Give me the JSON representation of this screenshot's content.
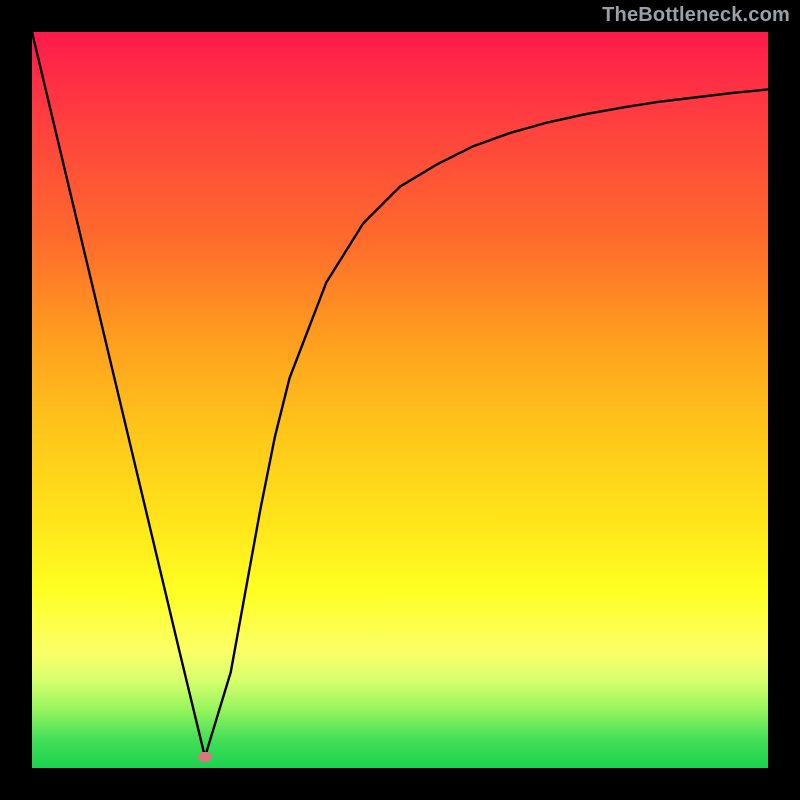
{
  "watermark": "TheBottleneck.com",
  "chart_data": {
    "type": "line",
    "title": "",
    "xlabel": "",
    "ylabel": "",
    "xlim": [
      0,
      1
    ],
    "ylim": [
      0,
      1
    ],
    "grid": false,
    "legend": false,
    "series": [
      {
        "name": "curve",
        "stroke": "#000000",
        "stroke_width": 2.4,
        "x": [
          0.0,
          0.05,
          0.1,
          0.15,
          0.2,
          0.235,
          0.27,
          0.29,
          0.31,
          0.33,
          0.35,
          0.4,
          0.45,
          0.5,
          0.55,
          0.6,
          0.65,
          0.7,
          0.75,
          0.8,
          0.85,
          0.9,
          0.95,
          1.0
        ],
        "y": [
          1.0,
          0.79,
          0.58,
          0.37,
          0.16,
          0.015,
          0.13,
          0.24,
          0.35,
          0.45,
          0.53,
          0.66,
          0.74,
          0.79,
          0.82,
          0.845,
          0.863,
          0.877,
          0.888,
          0.897,
          0.905,
          0.911,
          0.917,
          0.922
        ]
      }
    ],
    "marker": {
      "x": 0.235,
      "y": 0.015,
      "color": "#d47a7c"
    },
    "background_gradient": {
      "type": "vertical",
      "stops": [
        {
          "pos": 0.0,
          "color": "#ff1a4b"
        },
        {
          "pos": 0.28,
          "color": "#ff6a2c"
        },
        {
          "pos": 0.55,
          "color": "#ffc81a"
        },
        {
          "pos": 0.76,
          "color": "#ffff22"
        },
        {
          "pos": 0.92,
          "color": "#97f55d"
        },
        {
          "pos": 1.0,
          "color": "#1bd24e"
        }
      ]
    }
  }
}
